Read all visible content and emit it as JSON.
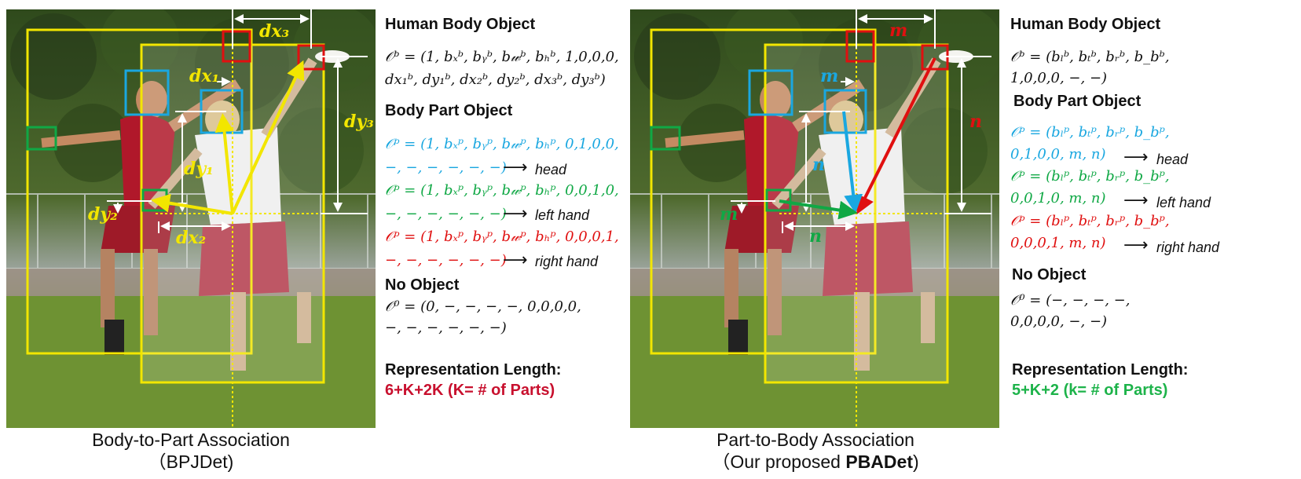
{
  "left": {
    "caption_line1": "Body-to-Part Association",
    "caption_line2": "（BPJDet)",
    "human_heading": "Human Body Object",
    "human_eq_line1": "𝒪ᵇ = (1, bₓᵇ, bᵧᵇ, b𝓌ᵇ, bₕᵇ, 1,0,0,0,",
    "human_eq_line2": "d𝑥₁ᵇ, d𝑦₁ᵇ, d𝑥₂ᵇ, d𝑦₂ᵇ, d𝑥₃ᵇ, d𝑦₃ᵇ)",
    "part_heading": "Body Part Object",
    "head_eq_line1": "𝒪ᵖ = (1, bₓᵖ, bᵧᵖ, b𝓌ᵖ, bₕᵖ, 0,1,0,0,",
    "head_eq_line2": "−, −, −, −, −, −)",
    "head_tag": "head",
    "lhand_eq_line1": "𝒪ᵖ = (1, bₓᵖ, bᵧᵖ, b𝓌ᵖ, bₕᵖ, 0,0,1,0,",
    "lhand_eq_line2": "−, −, −, −, −, −)",
    "lhand_tag": "left hand",
    "rhand_eq_line1": "𝒪ᵖ = (1, bₓᵖ, bᵧᵖ, b𝓌ᵖ, bₕᵖ, 0,0,0,1,",
    "rhand_eq_line2": "−, −, −, −, −, −)",
    "rhand_tag": "right hand",
    "noobj_heading": "No Object",
    "noobj_eq_line1": "𝒪⁰ = (0, −, −, −, −, 0,0,0,0,",
    "noobj_eq_line2": "−, −, −, −, −, −)",
    "len_heading": "Representation Length:",
    "len_value": "6+K+2K  (K= # of Parts)",
    "labels": {
      "dx3": "dx₃",
      "dx1": "dx₁",
      "dy3": "dy₃",
      "dy1": "dy₁",
      "dy2": "dy₂",
      "dx2": "dx₂"
    }
  },
  "right": {
    "caption_line1": "Part-to-Body Association",
    "caption_prefix": "（Our proposed ",
    "caption_bold": "PBADet",
    "caption_suffix": ")",
    "human_heading": "Human Body Object",
    "human_eq_line1": "𝒪ᵇ = (bₗᵇ, bₜᵇ, bᵣᵇ, b_bᵇ,",
    "human_eq_line2": "1,0,0,0, −, −)",
    "part_heading": "Body Part Object",
    "head_eq_line1": "𝒪ᵖ = (bₗᵖ, bₜᵖ, bᵣᵖ, b_bᵖ,",
    "head_eq_line2": "0,1,0,0, m, n)",
    "head_tag": "head",
    "lhand_eq_line1": "𝒪ᵖ = (bₗᵖ, bₜᵖ, bᵣᵖ, b_bᵖ,",
    "lhand_eq_line2": "0,0,1,0, m, n)",
    "lhand_tag": "left hand",
    "rhand_eq_line1": "𝒪ᵖ = (bₗᵖ, bₜᵖ, bᵣᵖ, b_bᵖ,",
    "rhand_eq_line2": "0,0,0,1, m, n)",
    "rhand_tag": "right hand",
    "noobj_heading": "No Object",
    "noobj_eq_line1": "𝒪⁰ = (−, −, −, −,",
    "noobj_eq_line2": "0,0,0,0, −, −)",
    "len_heading": "Representation Length:",
    "len_value": "5+K+2  (k= # of Parts)",
    "labels": {
      "m_top": "m",
      "m_head": "m",
      "n_right": "n",
      "n_mid": "n",
      "m_left": "m",
      "n_bottom": "n"
    }
  },
  "colors": {
    "yellow_box": "#f2e600",
    "cyan": "#1aa7e0",
    "green": "#10a845",
    "red": "#e01010",
    "grass": "#6f8f3a",
    "trees": "#3e5226"
  }
}
